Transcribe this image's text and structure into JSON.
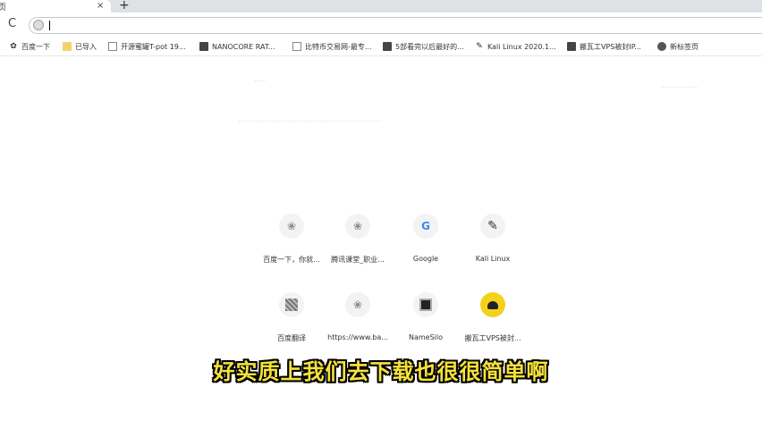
{
  "tab": {
    "title": "页",
    "close": "×"
  },
  "new_tab": "+",
  "toolbar": {
    "reload": "C",
    "omnibox_value": "",
    "omnibox_placeholder": ""
  },
  "bookmarks": [
    {
      "label": "百度一下",
      "icon": "paw-icon"
    },
    {
      "label": "已导入",
      "icon": "folder-icon"
    },
    {
      "label": "开源蜜罐T-pot 19...",
      "icon": "doc-icon"
    },
    {
      "label": "NANOCORE RAT...",
      "icon": "nanocore-icon"
    },
    {
      "label": "比特币交易网-最专...",
      "icon": "doc-icon"
    },
    {
      "label": "5部看完以后最好的...",
      "icon": "page-icon"
    },
    {
      "label": "Kali Linux 2020.1...",
      "icon": "kali-icon"
    },
    {
      "label": "搬瓦工VPS被封IP...",
      "icon": "bandwagon-icon"
    },
    {
      "label": "新标签页",
      "icon": "globe-icon"
    }
  ],
  "shortcuts": [
    {
      "label": "百度一下，你就...",
      "icon": "baidu-icon",
      "glyph": "❀"
    },
    {
      "label": "腾讯课堂_职业...",
      "icon": "tencent-icon",
      "glyph": "❀"
    },
    {
      "label": "Google",
      "icon": "google-icon",
      "glyph": "G"
    },
    {
      "label": "Kali Linux",
      "icon": "kali-dragon-icon",
      "glyph": "✎"
    },
    {
      "label": "百度翻译",
      "icon": "qr-icon",
      "glyph": ""
    },
    {
      "label": "https://www.ba...",
      "icon": "baidu-icon",
      "glyph": "❀"
    },
    {
      "label": "NameSilo",
      "icon": "namesilo-icon",
      "glyph": ""
    },
    {
      "label": "搬瓦工VPS被封...",
      "icon": "bandwagon-icon",
      "glyph": ""
    }
  ],
  "subtitle": "好实质上我们去下载也很很简单啊",
  "colors": {
    "subtitle": "#f5e23a",
    "tabstrip": "#dee1e6"
  }
}
